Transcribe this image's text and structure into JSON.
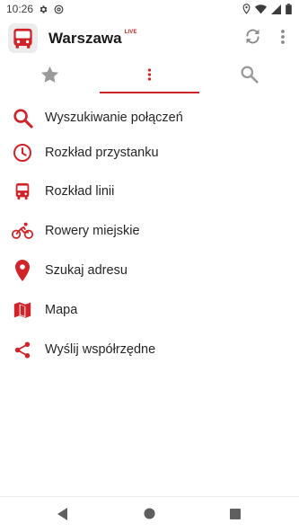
{
  "status_bar": {
    "time": "10:26",
    "icons_left": [
      "gear-icon",
      "at-sign-icon"
    ],
    "icons_right": [
      "location-icon",
      "wifi-icon",
      "signal-icon",
      "battery-icon"
    ]
  },
  "app_bar": {
    "title": "Warszawa",
    "badge": "LIVE",
    "logo_icon": "bus-logo-icon",
    "actions": [
      "refresh-icon",
      "more-vertical-icon"
    ]
  },
  "tabs": [
    {
      "icon": "star-icon",
      "selected": false
    },
    {
      "icon": "more-vertical-icon",
      "selected": true
    },
    {
      "icon": "search-icon",
      "selected": false
    }
  ],
  "menu": {
    "items": [
      {
        "label": "Wyszukiwanie połączeń",
        "icon": "search-icon"
      },
      {
        "label": "Rozkład przystanku",
        "icon": "clock-icon"
      },
      {
        "label": "Rozkład linii",
        "icon": "bus-icon"
      },
      {
        "label": "Rowery miejskie",
        "icon": "bike-icon"
      },
      {
        "label": "Szukaj adresu",
        "icon": "location-pin-icon"
      },
      {
        "label": "Mapa",
        "icon": "map-icon"
      },
      {
        "label": "Wyślij współrzędne",
        "icon": "share-icon"
      }
    ]
  },
  "colors": {
    "accent": "#d0232a",
    "tab_icon_inactive": "#9a9a9a",
    "text_primary": "#262626",
    "background": "#ffffff"
  },
  "nav_bar": {
    "buttons": [
      "back-icon",
      "home-icon",
      "recents-icon"
    ]
  }
}
